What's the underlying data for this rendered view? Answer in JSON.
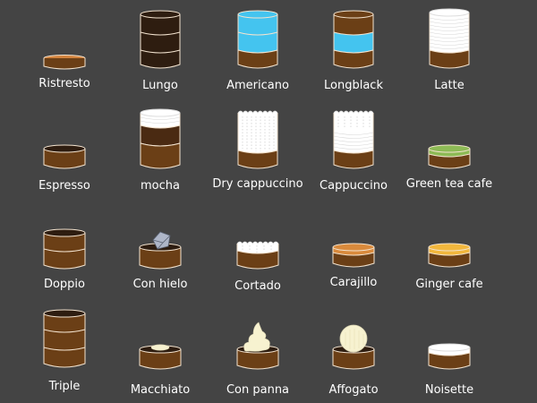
{
  "palette": {
    "background": "#444444",
    "espresso": "#6b3f16",
    "cup_edge": "#f3e3cf",
    "dark_coffee": "#2e1d10",
    "water": "#44c4ef",
    "milk": "#ffffff",
    "foam_line": "#cfcfcf",
    "mocha_chocolate": "#4a2a12",
    "green_tea": "#8dba55",
    "caramel": "#d98a3c",
    "ginger": "#f2b73d",
    "ice": "#aeb6c8",
    "whipped_cream": "#f7f2d0",
    "ice_cream": "#f7f2d0",
    "crema": "#d2833d"
  },
  "drinks": [
    {
      "label": "Ristresto",
      "icon": "ristretto-cup-icon"
    },
    {
      "label": "Lungo",
      "icon": "lungo-cup-icon"
    },
    {
      "label": "Americano",
      "icon": "americano-cup-icon"
    },
    {
      "label": "Longblack",
      "icon": "longblack-cup-icon"
    },
    {
      "label": "Latte",
      "icon": "latte-cup-icon"
    },
    {
      "label": "Espresso",
      "icon": "espresso-cup-icon"
    },
    {
      "label": "mocha",
      "icon": "mocha-cup-icon"
    },
    {
      "label": "Dry cappuccino",
      "icon": "dry-cappuccino-cup-icon"
    },
    {
      "label": "Cappuccino",
      "icon": "cappuccino-cup-icon"
    },
    {
      "label": "Green tea cafe",
      "icon": "green-tea-cafe-cup-icon"
    },
    {
      "label": "Doppio",
      "icon": "doppio-cup-icon"
    },
    {
      "label": "Con hielo",
      "icon": "con-hielo-cup-icon"
    },
    {
      "label": "Cortado",
      "icon": "cortado-cup-icon"
    },
    {
      "label": "Carajillo",
      "icon": "carajillo-cup-icon"
    },
    {
      "label": "Ginger cafe",
      "icon": "ginger-cafe-cup-icon"
    },
    {
      "label": "Triple",
      "icon": "triple-cup-icon"
    },
    {
      "label": "Macchiato",
      "icon": "macchiato-cup-icon"
    },
    {
      "label": "Con panna",
      "icon": "con-panna-cup-icon"
    },
    {
      "label": "Affogato",
      "icon": "affogato-cup-icon"
    },
    {
      "label": "Noisette",
      "icon": "noisette-cup-icon"
    }
  ]
}
